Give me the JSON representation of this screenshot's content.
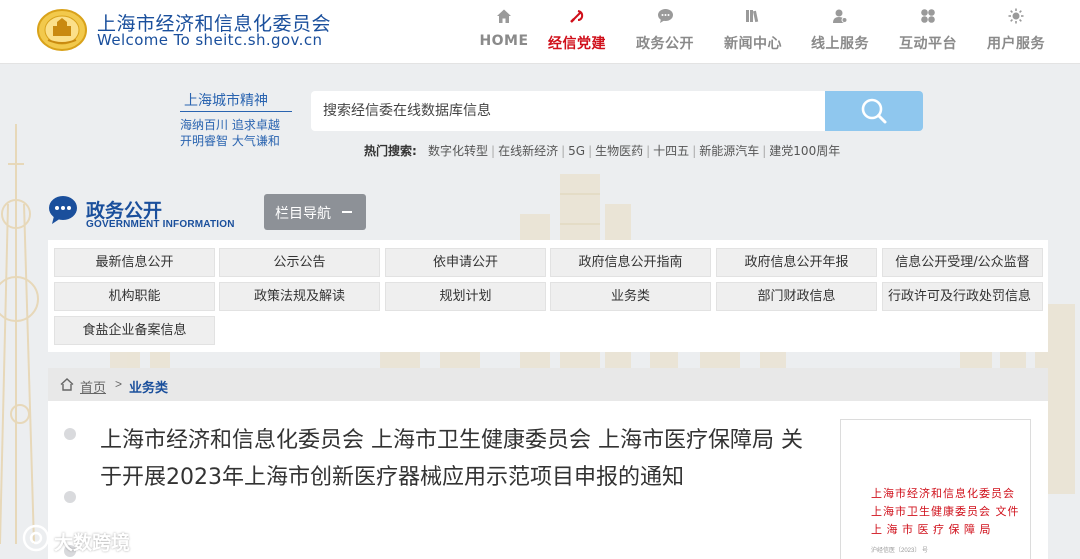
{
  "site": {
    "title": "上海市经济和信息化委员会",
    "url_line": "Welcome  To  sheitc.sh.gov.cn",
    "logo_icon": "city-emblem-icon"
  },
  "nav": [
    {
      "label": "HOME",
      "icon": "home-icon",
      "glyph": "⌂",
      "active": false
    },
    {
      "label": "经信党建",
      "icon": "party-emblem-icon",
      "glyph": "☭",
      "active": true
    },
    {
      "label": "政务公开",
      "icon": "chat-bubble-icon",
      "glyph": "💬",
      "active": false
    },
    {
      "label": "新闻中心",
      "icon": "books-icon",
      "glyph": "▥",
      "active": false
    },
    {
      "label": "线上服务",
      "icon": "user-icon",
      "glyph": "👤",
      "active": false
    },
    {
      "label": "互动平台",
      "icon": "grid-icon",
      "glyph": "❖",
      "active": false
    },
    {
      "label": "用户服务",
      "icon": "sun-icon",
      "glyph": "✹",
      "active": false
    }
  ],
  "slogan": {
    "title": "上海城市精神",
    "line1": "海纳百川  追求卓越",
    "line2": "开明睿智  大气谦和"
  },
  "search": {
    "placeholder": "搜索经信委在线数据库信息",
    "hot_label": "热门搜索:",
    "hot_keywords": [
      "数字化转型",
      "在线新经济",
      "5G",
      "生物医药",
      "十四五",
      "新能源汽车",
      "建党100周年"
    ]
  },
  "section": {
    "title": "政务公开",
    "subtitle": "GOVERNMENT INFORMATION",
    "nav_button": "栏目导航"
  },
  "categories": [
    "最新信息公开",
    "公示公告",
    "依申请公开",
    "政府信息公开指南",
    "政府信息公开年报",
    "信息公开受理/公众监督",
    "机构职能",
    "政策法规及解读",
    "规划计划",
    "业务类",
    "部门财政信息",
    "行政许可及行政处罚信息",
    "食盐企业备案信息"
  ],
  "breadcrumb": {
    "home": "首页",
    "separator": ">",
    "current": "业务类"
  },
  "article": {
    "title": "上海市经济和信息化委员会 上海市卫生健康委员会 上海市医疗保障局 关于开展2023年上海市创新医疗器械应用示范项目申报的通知"
  },
  "doc_preview": {
    "line1": "上海市经济和信息化委员会",
    "line2": "上海市卫生健康委员会  文件",
    "line3": "上 海 市 医 疗 保 障 局",
    "code": "沪经信医〔2023〕 号"
  },
  "watermark": {
    "text": "大数跨境"
  },
  "colors": {
    "brand_blue": "#1a4f9c",
    "active_red": "#d0101b",
    "search_button": "#8fc7ee"
  }
}
